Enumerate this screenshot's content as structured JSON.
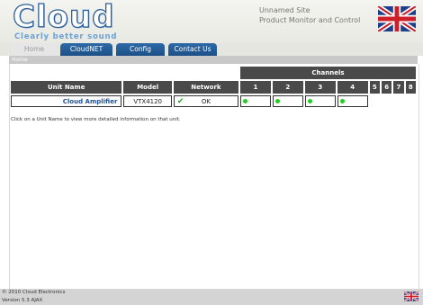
{
  "brand": {
    "logo_word": "Cloud",
    "tagline": "Clearly better sound"
  },
  "site": {
    "name": "Unnamed Site",
    "subtitle": "Product Monitor and Control"
  },
  "nav": {
    "tabs": [
      {
        "label": "Home",
        "active": true
      },
      {
        "label": "CloudNET",
        "active": false
      },
      {
        "label": "Config",
        "active": false
      },
      {
        "label": "Contact Us",
        "active": false
      }
    ]
  },
  "breadcrumb": "Home",
  "table": {
    "group_header": "Channels",
    "headers": {
      "unit_name": "Unit Name",
      "model": "Model",
      "network": "Network"
    },
    "channel_numbers": [
      "1",
      "2",
      "3",
      "4",
      "5",
      "6",
      "7",
      "8"
    ],
    "rows": [
      {
        "unit_name": "Cloud Amplifier",
        "model": "VTX4120",
        "network_status": "OK",
        "channel_status": [
          "on",
          "on",
          "on",
          "on"
        ]
      }
    ]
  },
  "info_text": "Click on a Unit Name to view more detailed information on that unit.",
  "footer": {
    "copyright": "© 2010 Cloud Electronics",
    "version": "Version 5.3 AJAX"
  },
  "colors": {
    "nav_tab": "#1c4f86",
    "header_cell": "#4a4a4a",
    "status_ok": "#22cc22",
    "link": "#1d4f9a"
  },
  "icons": {
    "language_flag": "union-jack-flag",
    "network_ok": "checkmark-icon"
  }
}
